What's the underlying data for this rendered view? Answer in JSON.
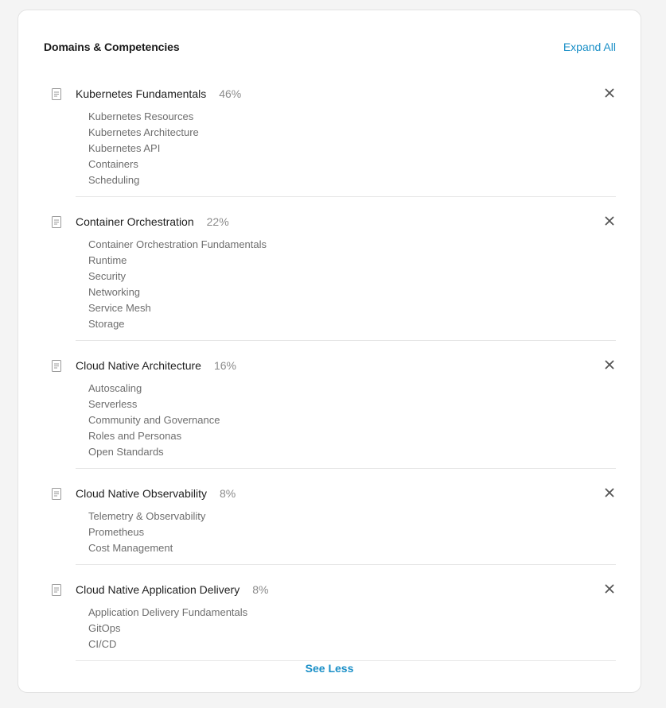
{
  "header": {
    "title": "Domains & Competencies",
    "expand_all_label": "Expand All"
  },
  "domains": [
    {
      "name": "Kubernetes Fundamentals",
      "percent": "46%",
      "competencies": [
        "Kubernetes Resources",
        "Kubernetes Architecture",
        "Kubernetes API",
        "Containers",
        "Scheduling"
      ]
    },
    {
      "name": "Container Orchestration",
      "percent": "22%",
      "competencies": [
        "Container Orchestration Fundamentals",
        "Runtime",
        "Security",
        "Networking",
        "Service Mesh",
        "Storage"
      ]
    },
    {
      "name": "Cloud Native Architecture",
      "percent": "16%",
      "competencies": [
        "Autoscaling",
        "Serverless",
        "Community and Governance",
        "Roles and Personas",
        "Open Standards"
      ]
    },
    {
      "name": "Cloud Native Observability",
      "percent": "8%",
      "competencies": [
        "Telemetry & Observability",
        "Prometheus",
        "Cost Management"
      ]
    },
    {
      "name": "Cloud Native Application Delivery",
      "percent": "8%",
      "competencies": [
        "Application Delivery Fundamentals",
        "GitOps",
        "CI/CD"
      ]
    }
  ],
  "footer": {
    "see_less_label": "See Less"
  },
  "colors": {
    "accent": "#1a8fc7",
    "text_primary": "#1f1f1f",
    "text_secondary": "#6e6e6e",
    "divider": "#e6e6e6"
  },
  "icons": {
    "domain": "document-icon",
    "remove": "close-icon"
  }
}
